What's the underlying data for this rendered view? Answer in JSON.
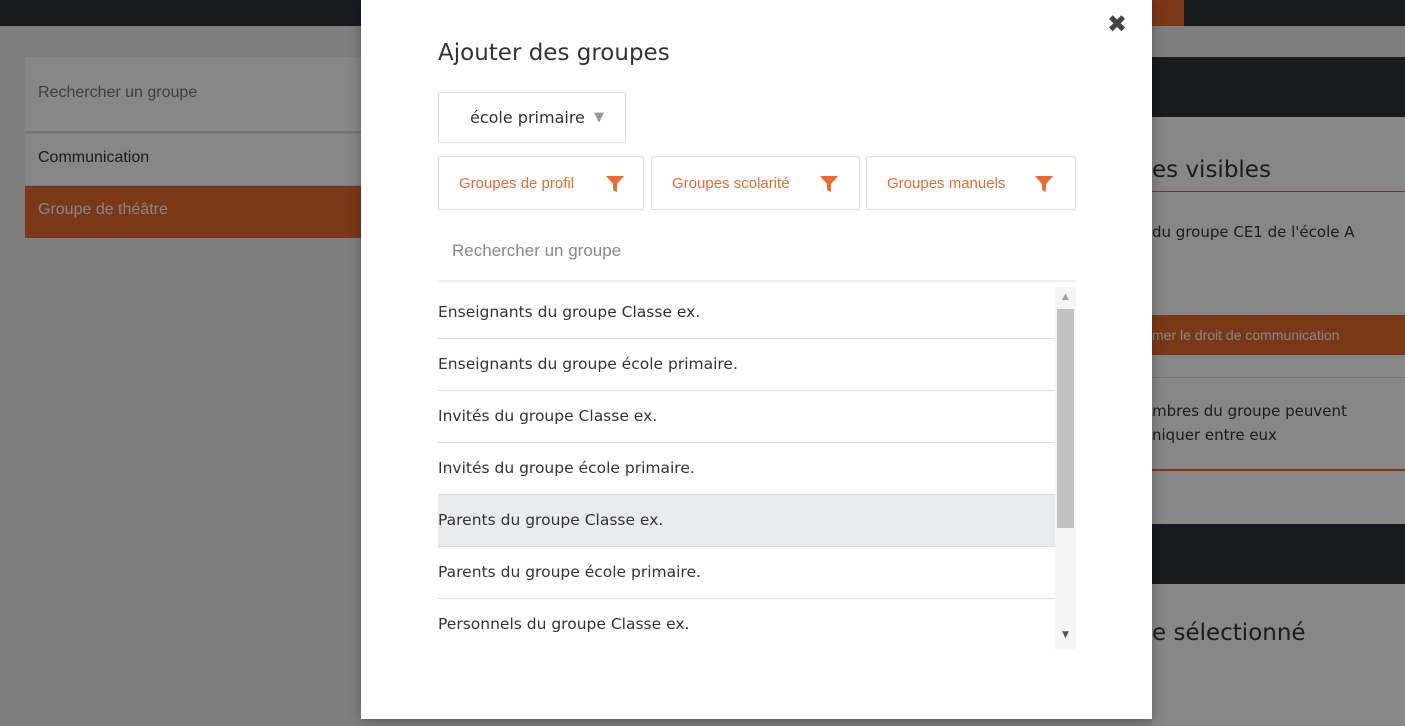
{
  "background": {
    "left_search_placeholder": "Rechercher un groupe",
    "left_items": [
      "Communication",
      "Groupe de théâtre"
    ],
    "right_heading": "es visibles",
    "right_desc": "du groupe CE1 de l'école A",
    "right_small_1": "",
    "right_small_2": "",
    "right_button": "mer le droit de communication",
    "right_member_line1": "mbres du groupe peuvent",
    "right_member_line2": "niquer entre eux",
    "right_heading2": "e sélectionné"
  },
  "modal": {
    "close_icon": "close-icon",
    "title": "Ajouter des groupes",
    "structure_select": {
      "value": "école primaire",
      "caret": "▼"
    },
    "filters": [
      {
        "label": "Groupes de profil",
        "icon": "filter-icon"
      },
      {
        "label": "Groupes scolarité",
        "icon": "filter-icon"
      },
      {
        "label": "Groupes manuels",
        "icon": "filter-icon"
      }
    ],
    "search": {
      "placeholder": "Rechercher un groupe",
      "value": ""
    },
    "groups": [
      "Enseignants du groupe Classe ex.",
      "Enseignants du groupe école primaire.",
      "Invités du groupe Classe ex.",
      "Invités du groupe école primaire.",
      "Parents du groupe Classe ex.",
      "Parents du groupe école primaire.",
      "Personnels du groupe Classe ex."
    ],
    "hovered_index": 4
  },
  "colors": {
    "accent": "#e96b2f",
    "dark": "#2f3339",
    "hover_row": "#e9ebee"
  }
}
